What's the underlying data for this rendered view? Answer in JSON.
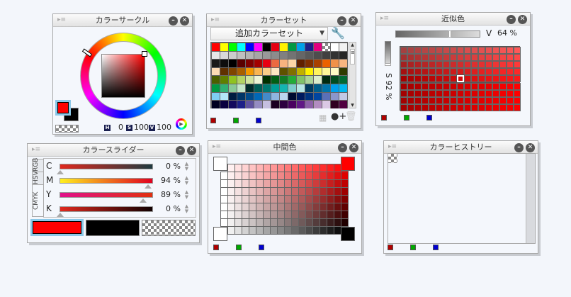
{
  "color_circle": {
    "title": "カラーサークル",
    "h_label": "H",
    "h": "0",
    "s_label": "S",
    "s": "100",
    "v_label": "V",
    "v": "100",
    "main_color": "#ff0000",
    "sub_color": "#000000"
  },
  "color_set": {
    "title": "カラーセット",
    "set_name": "追加カラーセット",
    "palette": [
      [
        "#ff0000",
        "#ffff00",
        "#00ff00",
        "#00ffff",
        "#0000ff",
        "#ff00ff",
        "#000000",
        "#e60012",
        "#fff100",
        "#009944",
        "#00a0e9",
        "#1d2088",
        "#e4007f",
        "transparent",
        "#ffffff",
        "#f2f2f2"
      ],
      [
        "#e6e6e6",
        "#d9d9d9",
        "#cccccc",
        "#bfbfbf",
        "#b3b3b3",
        "#a6a6a6",
        "#999999",
        "#8c8c8c",
        "#808080",
        "#737373",
        "#666666",
        "#595959",
        "#4d4d4d",
        "#404040",
        "#333333",
        "#262626"
      ],
      [
        "#1a1a1a",
        "#0d0d0d",
        "#000000",
        "#5a0000",
        "#7f0000",
        "#a40000",
        "#e60012",
        "#ec6941",
        "#f8b37f",
        "#fcd6a8",
        "#602000",
        "#7f2f00",
        "#a84000",
        "#eb6100",
        "#f19149",
        "#f8b580"
      ],
      [
        "#fddcb5",
        "#603000",
        "#7f4500",
        "#a85f00",
        "#f39800",
        "#f8b551",
        "#facd89",
        "#fde6c3",
        "#5f5200",
        "#807000",
        "#c0b000",
        "#fff100",
        "#fff45c",
        "#fff799",
        "#fffbc7",
        "#2f3a00"
      ],
      [
        "#4a6000",
        "#5f8000",
        "#8fc31f",
        "#b3d465",
        "#cfe3a0",
        "#ecf4d6",
        "#003000",
        "#005e15",
        "#107c28",
        "#22ac38",
        "#80c269",
        "#acd598",
        "#dbedcb",
        "#002b10",
        "#004d20",
        "#006934"
      ],
      [
        "#009944",
        "#31b075",
        "#89c997",
        "#c3e6ca",
        "#002b2b",
        "#005e57",
        "#007870",
        "#009e96",
        "#13b5b1",
        "#7ecdcc",
        "#b7e6e5",
        "#003a5e",
        "#005e8a",
        "#0075a9",
        "#00a0e9",
        "#00b7ee"
      ],
      [
        "#7ecef4",
        "#b3e5f7",
        "#001c40",
        "#003566",
        "#004a89",
        "#0068b7",
        "#448aca",
        "#8fb5e0",
        "#bcd6ef",
        "#000a30",
        "#001a5e",
        "#00337f",
        "#0045a0",
        "#5a70b8",
        "#8b96cb",
        "#c3c9e6"
      ],
      [
        "#000020",
        "#0a0040",
        "#130a5e",
        "#1d2088",
        "#5f52a0",
        "#958cc2",
        "#c5bfdf",
        "#1a0020",
        "#2e0040",
        "#4a0060",
        "#601986",
        "#8c60a8",
        "#b28cc0",
        "#dac8e4",
        "#300020",
        "#500040"
      ]
    ]
  },
  "similar_color": {
    "title": "近似色",
    "v_label": "V",
    "v_value": "64 %",
    "s_label": "S",
    "s_value": "92 %"
  },
  "color_slider": {
    "title": "カラースライダー",
    "tabs": [
      "RGB",
      "HSV",
      "CMYK"
    ],
    "active_tab": "CMYK",
    "channels": [
      {
        "label": "C",
        "value": "0 %"
      },
      {
        "label": "M",
        "value": "94 %"
      },
      {
        "label": "Y",
        "value": "89 %"
      },
      {
        "label": "K",
        "value": "0 %"
      }
    ],
    "channel_levels": [
      0,
      94,
      89,
      0
    ]
  },
  "intermediate_color": {
    "title": "中間色",
    "corner_top_left": "#ffffff",
    "corner_top_right": "#ff0000",
    "corner_bottom_left": "#ffffff",
    "corner_bottom_right": "#000000"
  },
  "color_history": {
    "title": "カラーヒストリー"
  },
  "rgb_indicator_colors": [
    "#b00000",
    "#00a800",
    "#0000d0"
  ]
}
